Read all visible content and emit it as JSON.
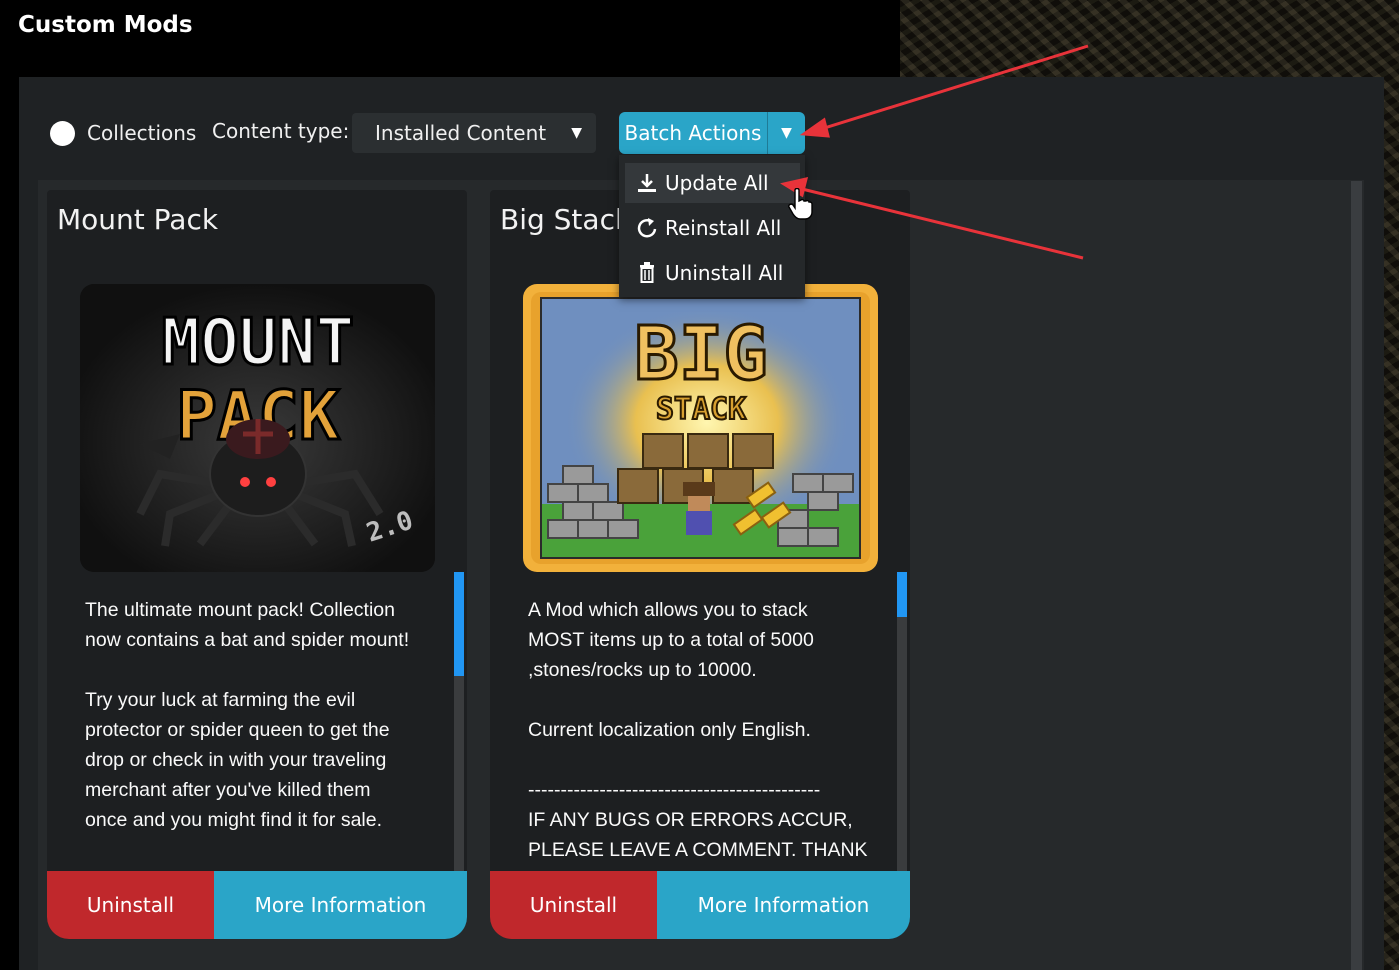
{
  "window": {
    "title": "Custom Mods"
  },
  "toolbar": {
    "collections_label": "Collections",
    "content_type_label": "Content type:",
    "content_type_value": "Installed Content",
    "batch_actions_label": "Batch Actions"
  },
  "batch_menu": {
    "items": [
      {
        "label": "Update All",
        "icon": "download-icon"
      },
      {
        "label": "Reinstall All",
        "icon": "refresh-icon"
      },
      {
        "label": "Uninstall All",
        "icon": "trash-icon"
      }
    ]
  },
  "mods": [
    {
      "title": "Mount Pack",
      "description": "The ultimate mount pack! Collection\nnow contains a bat and spider mount!\n\nTry your luck at farming the evil\nprotector or spider queen to get the\ndrop or check in with your traveling\nmerchant after you've killed them\nonce and you might find it for sale.",
      "uninstall_label": "Uninstall",
      "info_label": "More Information",
      "logo": {
        "line1": "MOUNT",
        "line2": "PACK",
        "badge": "2.0"
      }
    },
    {
      "title": "Big Stack",
      "description": "A Mod which allows you to stack\nMOST items up to a total of 5000\n,stones/rocks up to 10000.\n\nCurrent localization only English.\n\n---------------------------------------------\nIF ANY BUGS OR ERRORS ACCUR,\nPLEASE LEAVE A COMMENT. THANK",
      "uninstall_label": "Uninstall",
      "info_label": "More Information",
      "logo": {
        "line1": "BIG",
        "line2": "STACK"
      }
    }
  ],
  "colors": {
    "accent": "#2aa5c8",
    "danger": "#c0282c",
    "panel": "#1f2224",
    "annotation": "#e8333a"
  }
}
